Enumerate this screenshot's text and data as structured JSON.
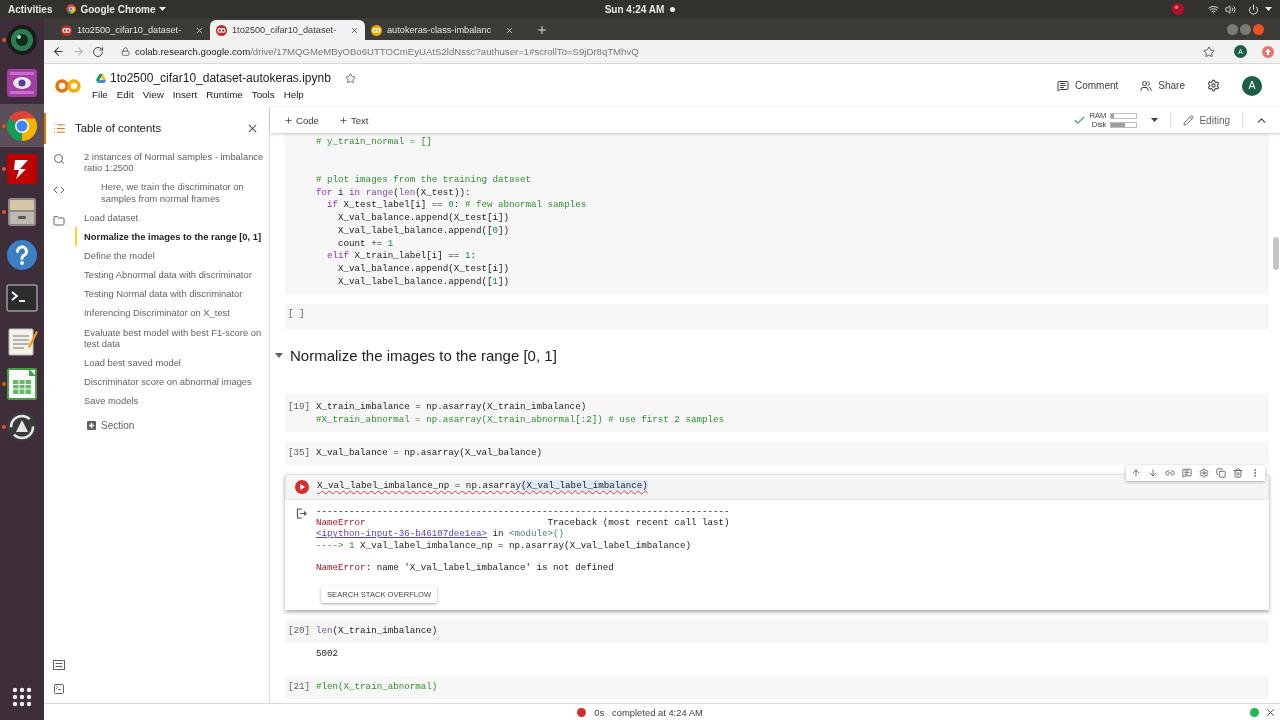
{
  "system_bar": {
    "activities": "Activities",
    "app_menu": "Google Chrome",
    "clock": "Sun 4:24 AM"
  },
  "dock": {
    "apps": [
      {
        "kind": "lens",
        "running": true,
        "selected": false
      },
      {
        "kind": "webcam",
        "running": false,
        "selected": false
      },
      {
        "kind": "browser",
        "running": true,
        "selected": true
      },
      {
        "kind": "ftp",
        "running": true,
        "selected": false
      },
      {
        "kind": "drawer",
        "running": true,
        "selected": false
      },
      {
        "kind": "help",
        "running": false,
        "selected": false
      },
      {
        "kind": "terminal",
        "running": false,
        "selected": false
      },
      {
        "kind": "notepad",
        "running": false,
        "selected": false
      },
      {
        "kind": "spreadsheet",
        "running": true,
        "selected": false
      },
      {
        "kind": "updater",
        "running": true,
        "selected": false
      }
    ]
  },
  "browser": {
    "tabs": [
      {
        "title": "1to2500_cifar10_dataset-",
        "error": true,
        "selected": false
      },
      {
        "title": "1to2500_cifar10_dataset-",
        "error": true,
        "selected": true
      },
      {
        "title": "autokeras-class-imbalanc",
        "error": false,
        "selected": false
      }
    ],
    "nav": [
      {
        "kind": "back",
        "disabled": false
      },
      {
        "kind": "forward",
        "disabled": true
      },
      {
        "kind": "reload",
        "disabled": false
      }
    ],
    "url_host": "colab.research.google.com",
    "url_path": "/drive/17MQGMeMByOBo6UTTOCmEyUAtS2ldNssc?authuser=1#scrollTo=S9jDr8qTMhvQ",
    "profile_initial": "A"
  },
  "header": {
    "title": "1to2500_cifar10_dataset-autokeras.ipynb",
    "menu": [
      "File",
      "Edit",
      "View",
      "Insert",
      "Runtime",
      "Tools",
      "Help"
    ],
    "comment": "Comment",
    "share": "Share",
    "avatar_initial": "A"
  },
  "toolbar": {
    "add": [
      "Code",
      "Text"
    ],
    "resources": {
      "connected": true,
      "ram_label": "RAM",
      "disk_label": "Disk",
      "ram": {
        "level": 0.1
      },
      "disk": {
        "level": 0.55
      }
    },
    "mode": "Editing"
  },
  "sidebar": {
    "rail": {
      "top": [
        {
          "kind": "toc",
          "selected": true
        },
        {
          "kind": "search",
          "selected": false
        },
        {
          "kind": "code",
          "selected": false
        },
        {
          "kind": "files",
          "selected": false
        }
      ],
      "bottom": [
        {
          "kind": "palette"
        },
        {
          "kind": "terminal"
        }
      ]
    },
    "toc": {
      "title": "Table of contents",
      "items": [
        {
          "text": "2 instances of Normal samples - imbalance ratio 1:2500",
          "selected": false,
          "children": [
            {
              "text": "Here, we train the discriminator on samples from normal frames",
              "selected": false
            }
          ]
        },
        {
          "text": "Load dataset",
          "selected": false
        },
        {
          "text": "Normalize the images to the range [0, 1]",
          "selected": true
        },
        {
          "text": "Define the model",
          "selected": false
        },
        {
          "text": "Testing Abnormal data with discriminator",
          "selected": false
        },
        {
          "text": "Testing Normal data with discriminator",
          "selected": false
        },
        {
          "text": "Inferencing Discriminator on X_test",
          "selected": false
        },
        {
          "text": "Evaluate best model with best F1-score on test data",
          "selected": false
        },
        {
          "text": "Load best saved model",
          "selected": false
        },
        {
          "text": "Discriminator score on abnormal images",
          "selected": false
        },
        {
          "text": "Save models",
          "selected": false
        }
      ],
      "add_section": "Section"
    }
  },
  "notebook": {
    "cells": [
      {
        "kind": "code",
        "focused": false,
        "lines": [
          {
            "kind": "code",
            "tokens": [
              {
                "text": "# y_train_normal = []",
                "kind": "comment"
              }
            ]
          },
          {
            "kind": "blank"
          },
          {
            "kind": "blank"
          },
          {
            "kind": "code",
            "tokens": [
              {
                "text": "# plot images from the training dataset",
                "kind": "comment"
              }
            ]
          },
          {
            "kind": "code",
            "tokens": [
              {
                "text": "for",
                "kind": "keyword"
              },
              {
                "text": " i ",
                "kind": "plain"
              },
              {
                "text": "in",
                "kind": "keyword"
              },
              {
                "text": " range",
                "kind": "builtin"
              },
              {
                "text": "(",
                "kind": "plain"
              },
              {
                "text": "len",
                "kind": "builtin"
              },
              {
                "text": "(X_test)):",
                "kind": "plain"
              }
            ]
          },
          {
            "kind": "code",
            "tokens": [
              {
                "text": "  if",
                "kind": "keyword"
              },
              {
                "text": " X_test_label[i] == ",
                "kind": "plain"
              },
              {
                "text": "0",
                "kind": "number"
              },
              {
                "text": ": ",
                "kind": "plain"
              },
              {
                "text": "# few abnormal samples",
                "kind": "comment"
              }
            ]
          },
          {
            "kind": "code",
            "tokens": [
              {
                "text": "    X_val_balance.append(X_test[i])",
                "kind": "plain"
              }
            ]
          },
          {
            "kind": "code",
            "tokens": [
              {
                "text": "    X_val_label_balance.append([",
                "kind": "plain"
              },
              {
                "text": "0",
                "kind": "number"
              },
              {
                "text": "])",
                "kind": "plain"
              }
            ]
          },
          {
            "kind": "code",
            "tokens": [
              {
                "text": "    count += ",
                "kind": "plain"
              },
              {
                "text": "1",
                "kind": "number"
              }
            ]
          },
          {
            "kind": "code",
            "tokens": [
              {
                "text": "  elif",
                "kind": "keyword"
              },
              {
                "text": " X_train_label[i] == ",
                "kind": "plain"
              },
              {
                "text": "1",
                "kind": "number"
              },
              {
                "text": ":",
                "kind": "plain"
              }
            ]
          },
          {
            "kind": "code",
            "tokens": [
              {
                "text": "    X_val_balance.append(X_test[i])",
                "kind": "plain"
              }
            ]
          },
          {
            "kind": "code",
            "tokens": [
              {
                "text": "    X_val_label_balance.append([",
                "kind": "plain"
              },
              {
                "text": "1",
                "kind": "number"
              },
              {
                "text": "])",
                "kind": "plain"
              }
            ]
          }
        ]
      },
      {
        "kind": "code",
        "focused": false,
        "prompt": "[ ]"
      },
      {
        "kind": "heading",
        "text": "Normalize the images to the range [0, 1]",
        "expanded": true
      },
      {
        "kind": "code",
        "focused": false,
        "prompt": "[19]",
        "lines": [
          {
            "kind": "code",
            "tokens": [
              {
                "text": "X_train_imbalance = np.asarray(X_train_imbalance)",
                "kind": "plain"
              }
            ]
          },
          {
            "kind": "code",
            "tokens": [
              {
                "text": "#X_train_abnormal = np.asarray(X_train_abnormal[:2]) # use first 2 samples",
                "kind": "comment"
              }
            ]
          }
        ]
      },
      {
        "kind": "code",
        "focused": false,
        "prompt": "[35]",
        "lines": [
          {
            "kind": "code",
            "tokens": [
              {
                "text": "X_val_balance = np.asarray(X_val_balance)",
                "kind": "plain"
              }
            ]
          }
        ]
      },
      {
        "kind": "code",
        "focused": true,
        "error": true,
        "lines": [
          {
            "kind": "code",
            "tokens": [
              {
                "text": "X_val_label_imbalance_np = np.asarray",
                "kind": "flagged"
              },
              {
                "text": "(X_val_label_imbalance)",
                "kind": "flagged_selection"
              }
            ]
          }
        ],
        "output": {
          "kind": "traceback",
          "lines": [
            {
              "kind": "code",
              "tokens": [
                {
                  "text": "---------------------------------------------------------------------------",
                  "kind": "plain"
                }
              ]
            },
            {
              "kind": "code",
              "tokens": [
                {
                  "text": "NameError",
                  "kind": "error_name"
                },
                {
                  "text": "                                 Traceback (most recent call last)",
                  "kind": "plain"
                }
              ]
            },
            {
              "kind": "code",
              "tokens": [
                {
                  "text": "<ipython-input-36-b46107dee1ea>",
                  "kind": "link"
                },
                {
                  "text": " in ",
                  "kind": "plain"
                },
                {
                  "text": "<module>()",
                  "kind": "module"
                }
              ]
            },
            {
              "kind": "code",
              "tokens": [
                {
                  "text": "----> 1",
                  "kind": "arrow"
                },
                {
                  "text": " X_val_label_imbalance_np = np.asarray(X_val_label_imbalance)",
                  "kind": "plain"
                }
              ]
            },
            {
              "kind": "blank"
            },
            {
              "kind": "code",
              "tokens": [
                {
                  "text": "NameError",
                  "kind": "error_name"
                },
                {
                  "text": ": name 'X_val_label_imbalance' is not defined",
                  "kind": "plain"
                }
              ]
            }
          ],
          "button": "SEARCH STACK OVERFLOW"
        }
      },
      {
        "kind": "code",
        "focused": false,
        "prompt": "[20]",
        "lines": [
          {
            "kind": "code",
            "tokens": [
              {
                "text": "len",
                "kind": "builtin"
              },
              {
                "text": "(X_train_imbalance)",
                "kind": "plain"
              }
            ]
          }
        ],
        "output": {
          "kind": "text",
          "lines": [
            {
              "kind": "code",
              "tokens": [
                {
                  "text": "5002",
                  "kind": "plain"
                }
              ]
            }
          ]
        }
      },
      {
        "kind": "code",
        "focused": false,
        "prompt": "[21]",
        "lines": [
          {
            "kind": "code",
            "tokens": [
              {
                "text": "#len(X_train_abnormal)",
                "kind": "comment"
              }
            ]
          }
        ]
      }
    ]
  },
  "status_bar": {
    "error": true,
    "elapsed": "0s",
    "message": "completed at 4:24 AM",
    "connected": true
  }
}
